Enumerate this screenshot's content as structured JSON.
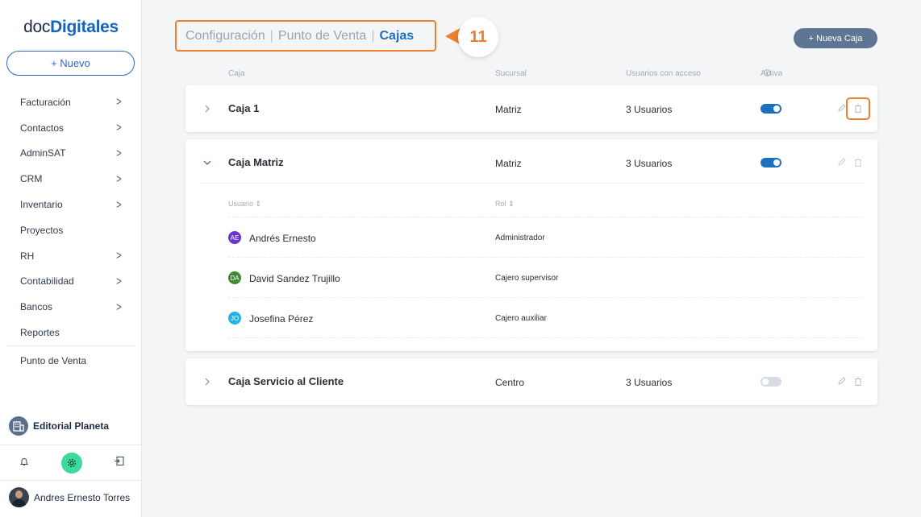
{
  "sidebar": {
    "logo_part1": "doc",
    "logo_part2": "Digitales",
    "new_button": "+ Nuevo",
    "nav": [
      {
        "label": "Facturación",
        "arrow": true
      },
      {
        "label": "Contactos",
        "arrow": true
      },
      {
        "label": "AdminSAT",
        "arrow": true
      },
      {
        "label": "CRM",
        "arrow": true
      },
      {
        "label": "Inventario",
        "arrow": true
      },
      {
        "label": "Proyectos",
        "arrow": false
      },
      {
        "label": "RH",
        "arrow": true
      },
      {
        "label": "Contabilidad",
        "arrow": true
      },
      {
        "label": "Bancos",
        "arrow": true
      },
      {
        "label": "Reportes",
        "arrow": false
      }
    ],
    "punto_venta": "Punto de Venta",
    "organization": "Editorial Planeta",
    "user_name": "Andres Ernesto Torres",
    "icons": [
      "bell-icon",
      "gear-icon",
      "logout-icon"
    ]
  },
  "breadcrumb": {
    "item1": "Configuración",
    "item2": "Punto de Venta",
    "item3": "Cajas",
    "separator": "|"
  },
  "callout_number": "11",
  "new_caja_button": "+ Nueva Caja",
  "columns": {
    "caja": "Caja",
    "sucursal": "Sucursal",
    "usuarios": "Usuarios con acceso",
    "activa": "Activa"
  },
  "cajas": [
    {
      "name": "Caja 1",
      "branch": "Matriz",
      "users": "3 Usuarios",
      "active": true,
      "expanded": false
    },
    {
      "name": "Caja Matriz",
      "branch": "Matriz",
      "users": "3 Usuarios",
      "active": true,
      "expanded": true
    },
    {
      "name": "Caja Servicio al Cliente",
      "branch": "Centro",
      "users": "3 Usuarios",
      "active": false,
      "expanded": false
    }
  ],
  "members_header": {
    "usuario": "Usuario",
    "rol": "Rol"
  },
  "members": [
    {
      "initials": "AE",
      "name": "Andrés Ernesto",
      "role": "Administrador",
      "color": "#6a35c9"
    },
    {
      "initials": "DA",
      "name": "David Sandez Trujillo",
      "role": "Cajero supervisor",
      "color": "#3f8a2f"
    },
    {
      "initials": "JO",
      "name": "Josefina Pérez",
      "role": "Cajero auxiliar",
      "color": "#1fb4e8"
    }
  ],
  "colors": {
    "accent": "#1f6fbf",
    "highlight": "#ee7f2d",
    "button": "#5e7593"
  }
}
